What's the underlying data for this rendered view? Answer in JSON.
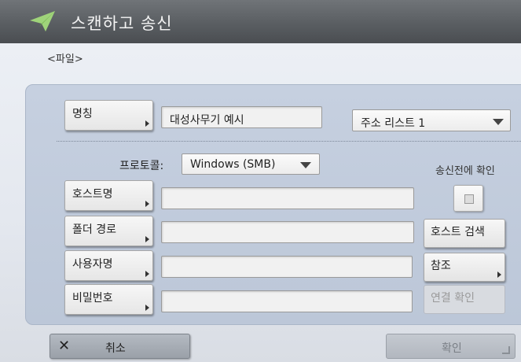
{
  "header": {
    "title": "스캔하고 송신",
    "icon": "send-paper-plane-icon"
  },
  "section": {
    "label": "<파일>"
  },
  "name": {
    "label": "명칭",
    "value": "대성사무기 예시"
  },
  "address_list": {
    "value": "주소 리스트 1"
  },
  "protocol": {
    "label": "프로토콜:",
    "value": "Windows (SMB)"
  },
  "confirm_before_send": {
    "label": "송신전에 확인"
  },
  "fields": {
    "host_name": {
      "label": "호스트명",
      "value": ""
    },
    "folder_path": {
      "label": "폴더 경로",
      "value": ""
    },
    "user_name": {
      "label": "사용자명",
      "value": ""
    },
    "password": {
      "label": "비밀번호",
      "value": ""
    }
  },
  "buttons": {
    "host_search": "호스트 검색",
    "browse": "참조",
    "connection_check": "연결 확인",
    "cancel": "취소",
    "ok": "확인"
  },
  "colors": {
    "header": "#5a5e62",
    "panel": "#c2cce0"
  }
}
